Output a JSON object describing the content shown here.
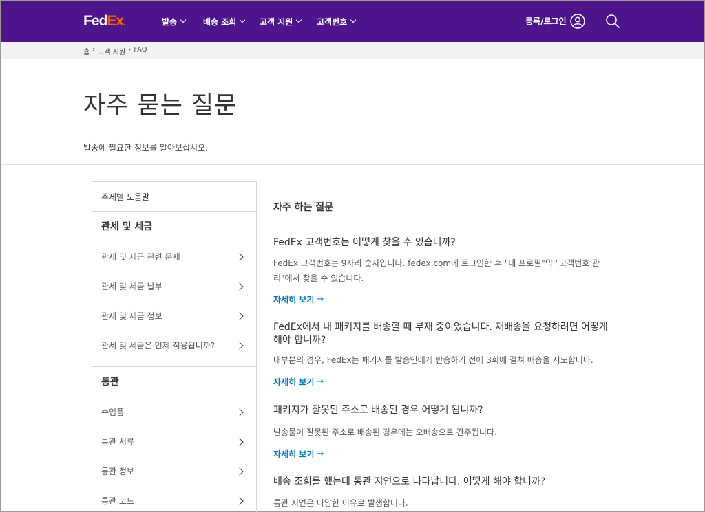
{
  "header": {
    "logo_fed": "Fed",
    "logo_ex": "Ex",
    "logo_dot": ".",
    "nav": [
      "발송",
      "배송 조회",
      "고객 지원",
      "고객번호"
    ],
    "login": "등록/로그인"
  },
  "breadcrumb": [
    "홈",
    "›",
    "고객 지원",
    "›",
    "FAQ"
  ],
  "page": {
    "title": "자주 묻는 질문",
    "subtitle": "발송에 필요한 정보를 알아보십시오."
  },
  "sidebar": {
    "heading": "주제별 도움말",
    "groups": [
      {
        "title": "관세 및 세금",
        "items": [
          "관세 및 세금 관련 문제",
          "관세 및 세금 납부",
          "관세 및 세금 정보",
          "관세 및 세금은 언제 적용됩니까?"
        ]
      },
      {
        "title": "통관",
        "items": [
          "수입품",
          "통관 서류",
          "통관 정보",
          "통관 코드"
        ]
      }
    ]
  },
  "faq": {
    "heading": "자주 하는 질문",
    "more_label": "자세히 보기",
    "items": [
      {
        "question": "FedEx 고객번호는 어떻게 찾을 수 있습니까?",
        "answer": "FedEx 고객번호는 9자리 숫자입니다. fedex.com에 로그인한 후 \"내 프로필\"의 \"고객번호 관리\"에서 찾을 수 있습니다."
      },
      {
        "question": "FedEx에서 내 패키지를 배송할 때 부재 중이었습니다. 재배송을 요청하려면 어떻게 해야 합니까?",
        "answer": "대부분의 경우, FedEx는 패키지를 발송인에게 반송하기 전에 3회에 걸쳐 배송을 시도합니다."
      },
      {
        "question": "패키지가 잘못된 주소로 배송된 경우 어떻게 됩니까?",
        "answer": "발송물이 잘못된 주소로 배송된 경우에는 오배송으로 간주됩니다."
      },
      {
        "question": "배송 조회를 했는데 통관 지연으로 나타납니다. 어떻게 해야 합니까?",
        "answer": "통관 지연은 다양한 이유로 발생합니다."
      }
    ]
  }
}
